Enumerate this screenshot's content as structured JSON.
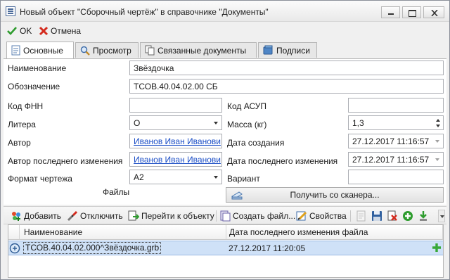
{
  "window": {
    "title": "Новый объект \"Сборочный чертёж\" в справочнике \"Документы\""
  },
  "toolbar": {
    "ok_label": "OK",
    "cancel_label": "Отмена"
  },
  "tabs": [
    {
      "label": "Основные",
      "active": true
    },
    {
      "label": "Просмотр",
      "active": false
    },
    {
      "label": "Связанные документы",
      "active": false
    },
    {
      "label": "Подписи",
      "active": false
    }
  ],
  "form": {
    "name_label": "Наименование",
    "name_value": "Звёздочка",
    "designation_label": "Обозначение",
    "designation_value": "ТСОВ.40.04.02.00 СБ",
    "fnn_label": "Код ФНН",
    "fnn_value": "",
    "asup_label": "Код АСУП",
    "asup_value": "",
    "litera_label": "Литера",
    "litera_value": "О",
    "mass_label": "Масса (кг)",
    "mass_value": "1,3",
    "author_label": "Автор",
    "author_value": "Иванов Иван Иванови",
    "created_label": "Дата создания",
    "created_value": "27.12.2017 11:16:57",
    "last_author_label": "Автор последнего изменения",
    "last_author_value": "Иванов Иван Иванови",
    "modified_label": "Дата последнего изменения",
    "modified_value": "27.12.2017 11:16:57",
    "format_label": "Формат чертежа",
    "format_value": "А2",
    "variant_label": "Вариант",
    "variant_value": "",
    "files_label": "Файлы",
    "scan_button": "Получить со сканера..."
  },
  "files_toolbar": {
    "add": "Добавить",
    "detach": "Отключить",
    "goto": "Перейти к объекту",
    "create": "Создать файл...",
    "properties": "Свойства"
  },
  "files_grid": {
    "columns": [
      "Наименование",
      "Дата последнего изменения файла"
    ],
    "rows": [
      {
        "name": "ТСОВ.40.04.02.000^Звёздочка.grb",
        "date": "27.12.2017 11:20:05"
      }
    ]
  },
  "colors": {
    "link": "#1b4ec6",
    "selection": "#cfe1f7",
    "ok_green": "#2e9c2e",
    "cancel_red": "#d42b1e"
  }
}
